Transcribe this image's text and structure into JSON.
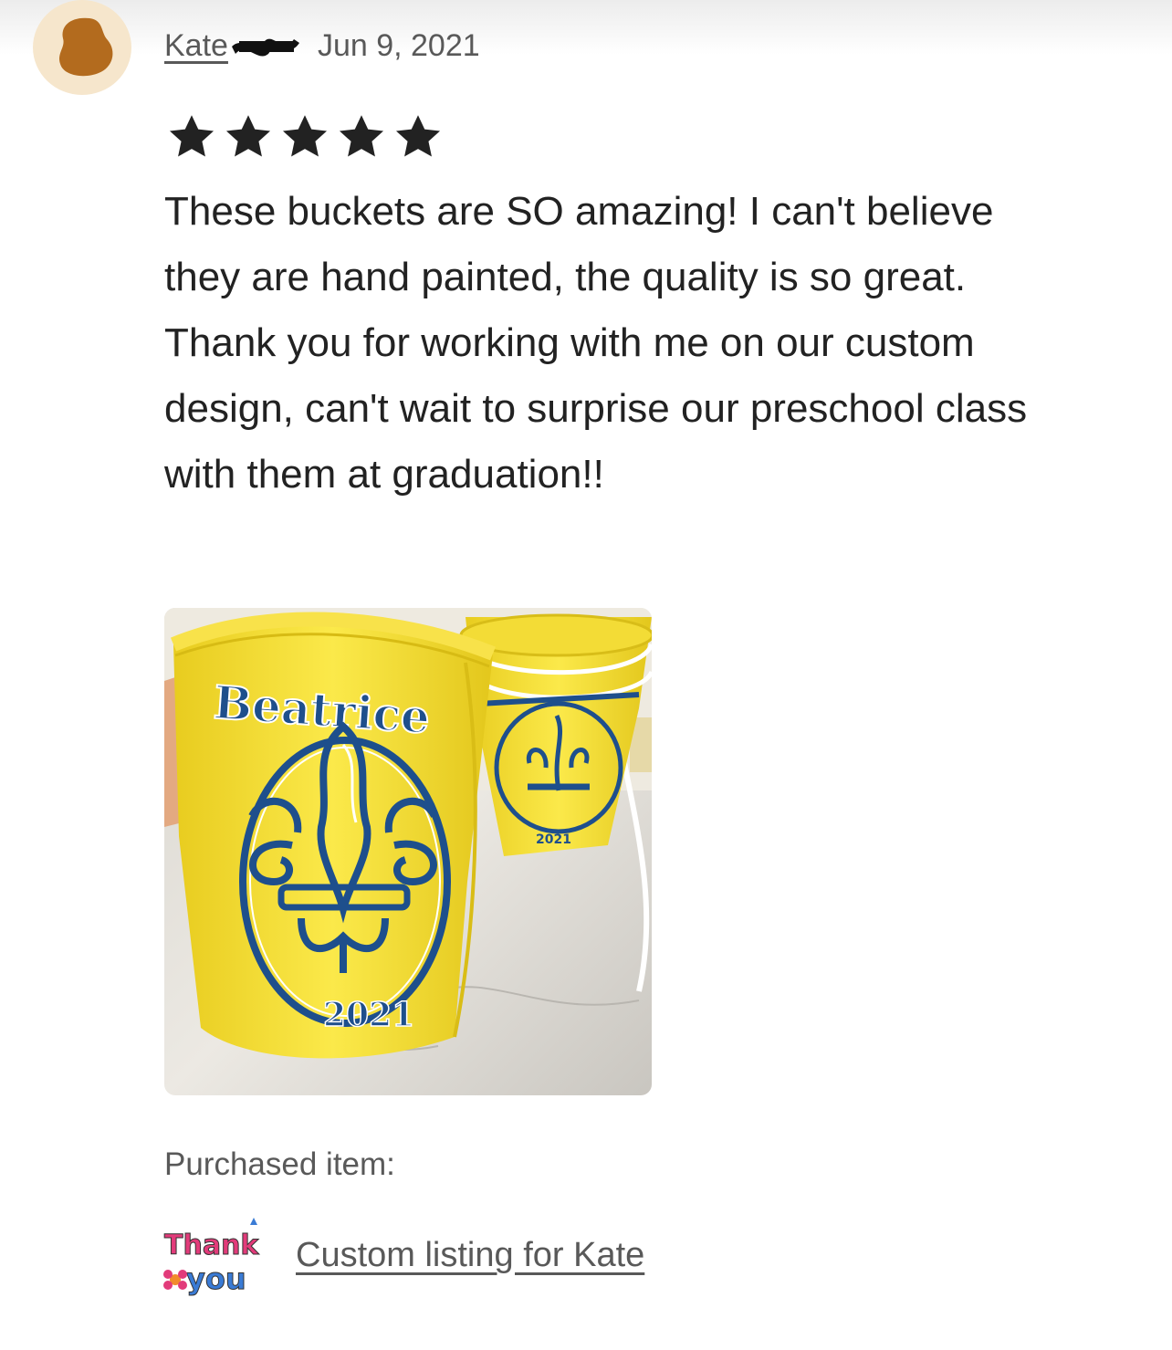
{
  "review": {
    "reviewer_name": "Kate",
    "date": "Jun 9, 2021",
    "rating": 5,
    "rating_max": 5,
    "text": "These buckets are SO amazing! I can't believe they are hand painted, the quality is so great. Thank you for working with me on our custom design, can't wait to surprise our preschool class with them at graduation!!",
    "photo": {
      "name_text": "Beatrice",
      "year_text": "2021",
      "back_year_text": "2021"
    }
  },
  "purchased": {
    "label": "Purchased item:",
    "thumb_text_1": "Thank",
    "thumb_text_2": "you",
    "listing_title": "Custom listing for Kate"
  },
  "colors": {
    "star": "#222222",
    "avatar_bg": "#f6e6cc",
    "avatar_fg": "#b36b1e",
    "bucket_yellow": "#f7e23a",
    "bucket_navy": "#1e4f8c"
  },
  "icons": {
    "star": "star-icon",
    "avatar": "avatar-icon"
  }
}
